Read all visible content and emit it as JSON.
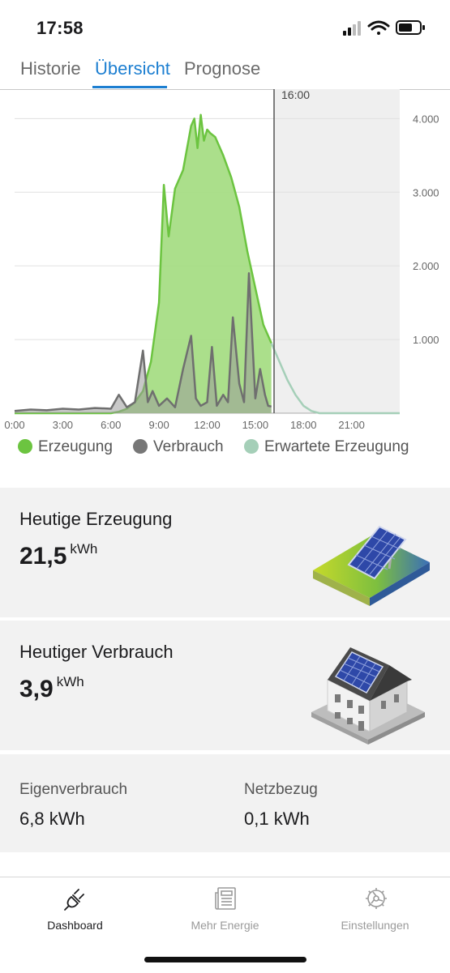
{
  "status": {
    "time": "17:58"
  },
  "tabs": [
    {
      "label": "Historie",
      "active": false
    },
    {
      "label": "Übersicht",
      "active": true
    },
    {
      "label": "Prognose",
      "active": false
    }
  ],
  "colors": {
    "accent": "#1d7fd1",
    "erzeugung": "#6cc440",
    "verbrauch": "#7a7a7a",
    "erwartet": "#a5cfb8"
  },
  "chart_data": {
    "type": "area",
    "now_label": "16:00",
    "x_unit": "hours",
    "x_ticks": [
      "0:00",
      "3:00",
      "6:00",
      "9:00",
      "12:00",
      "15:00",
      "18:00",
      "21:00"
    ],
    "y_ticks": [
      "1.000",
      "2.000",
      "3.000",
      "4.000"
    ],
    "ylim": [
      0,
      4400
    ],
    "xlim": [
      0,
      24
    ],
    "legend": [
      "Erzeugung",
      "Verbrauch",
      "Erwartete Erzeugung"
    ],
    "series": [
      {
        "name": "Erzeugung",
        "x": [
          0,
          6,
          6.5,
          7,
          7.5,
          8,
          8.5,
          9,
          9.3,
          9.6,
          10,
          10.5,
          11,
          11.2,
          11.4,
          11.6,
          11.8,
          12,
          12.2,
          12.5,
          13,
          13.5,
          14,
          14.5,
          15,
          15.5,
          16
        ],
        "values": [
          0,
          0,
          20,
          60,
          150,
          300,
          700,
          1500,
          3100,
          2400,
          3050,
          3300,
          3900,
          4000,
          3600,
          4050,
          3700,
          3850,
          3800,
          3750,
          3500,
          3200,
          2800,
          2200,
          1700,
          1200,
          950
        ]
      },
      {
        "name": "Verbrauch",
        "x": [
          0,
          1,
          2,
          3,
          4,
          5,
          6,
          6.5,
          7,
          7.5,
          8,
          8.3,
          8.6,
          9,
          9.5,
          10,
          10.5,
          11,
          11.3,
          11.6,
          12,
          12.3,
          12.6,
          13,
          13.3,
          13.6,
          14,
          14.3,
          14.6,
          15,
          15.3,
          15.6,
          15.8,
          16
        ],
        "values": [
          30,
          50,
          40,
          60,
          50,
          70,
          60,
          250,
          80,
          150,
          850,
          150,
          300,
          100,
          200,
          80,
          600,
          1050,
          200,
          100,
          150,
          900,
          100,
          250,
          150,
          1300,
          400,
          150,
          1900,
          200,
          600,
          250,
          100,
          90
        ]
      },
      {
        "name": "Erwartete Erzeugung",
        "x": [
          16,
          16.5,
          17,
          17.5,
          18,
          18.5,
          19,
          24
        ],
        "values": [
          950,
          700,
          450,
          250,
          100,
          30,
          0,
          0
        ]
      }
    ]
  },
  "cards": {
    "erzeugung": {
      "title": "Heutige Erzeugung",
      "value": "21,5",
      "unit": "kWh"
    },
    "verbrauch": {
      "title": "Heutiger Verbrauch",
      "value": "3,9",
      "unit": "kWh"
    },
    "stats": [
      {
        "label": "Eigenverbrauch",
        "value": "6,8 kWh"
      },
      {
        "label": "Netzbezug",
        "value": "0,1 kWh"
      }
    ]
  },
  "nav": [
    {
      "label": "Dashboard",
      "icon": "plug-icon",
      "active": true
    },
    {
      "label": "Mehr Energie",
      "icon": "newspaper-icon",
      "active": false
    },
    {
      "label": "Einstellungen",
      "icon": "gear-icon",
      "active": false
    }
  ]
}
